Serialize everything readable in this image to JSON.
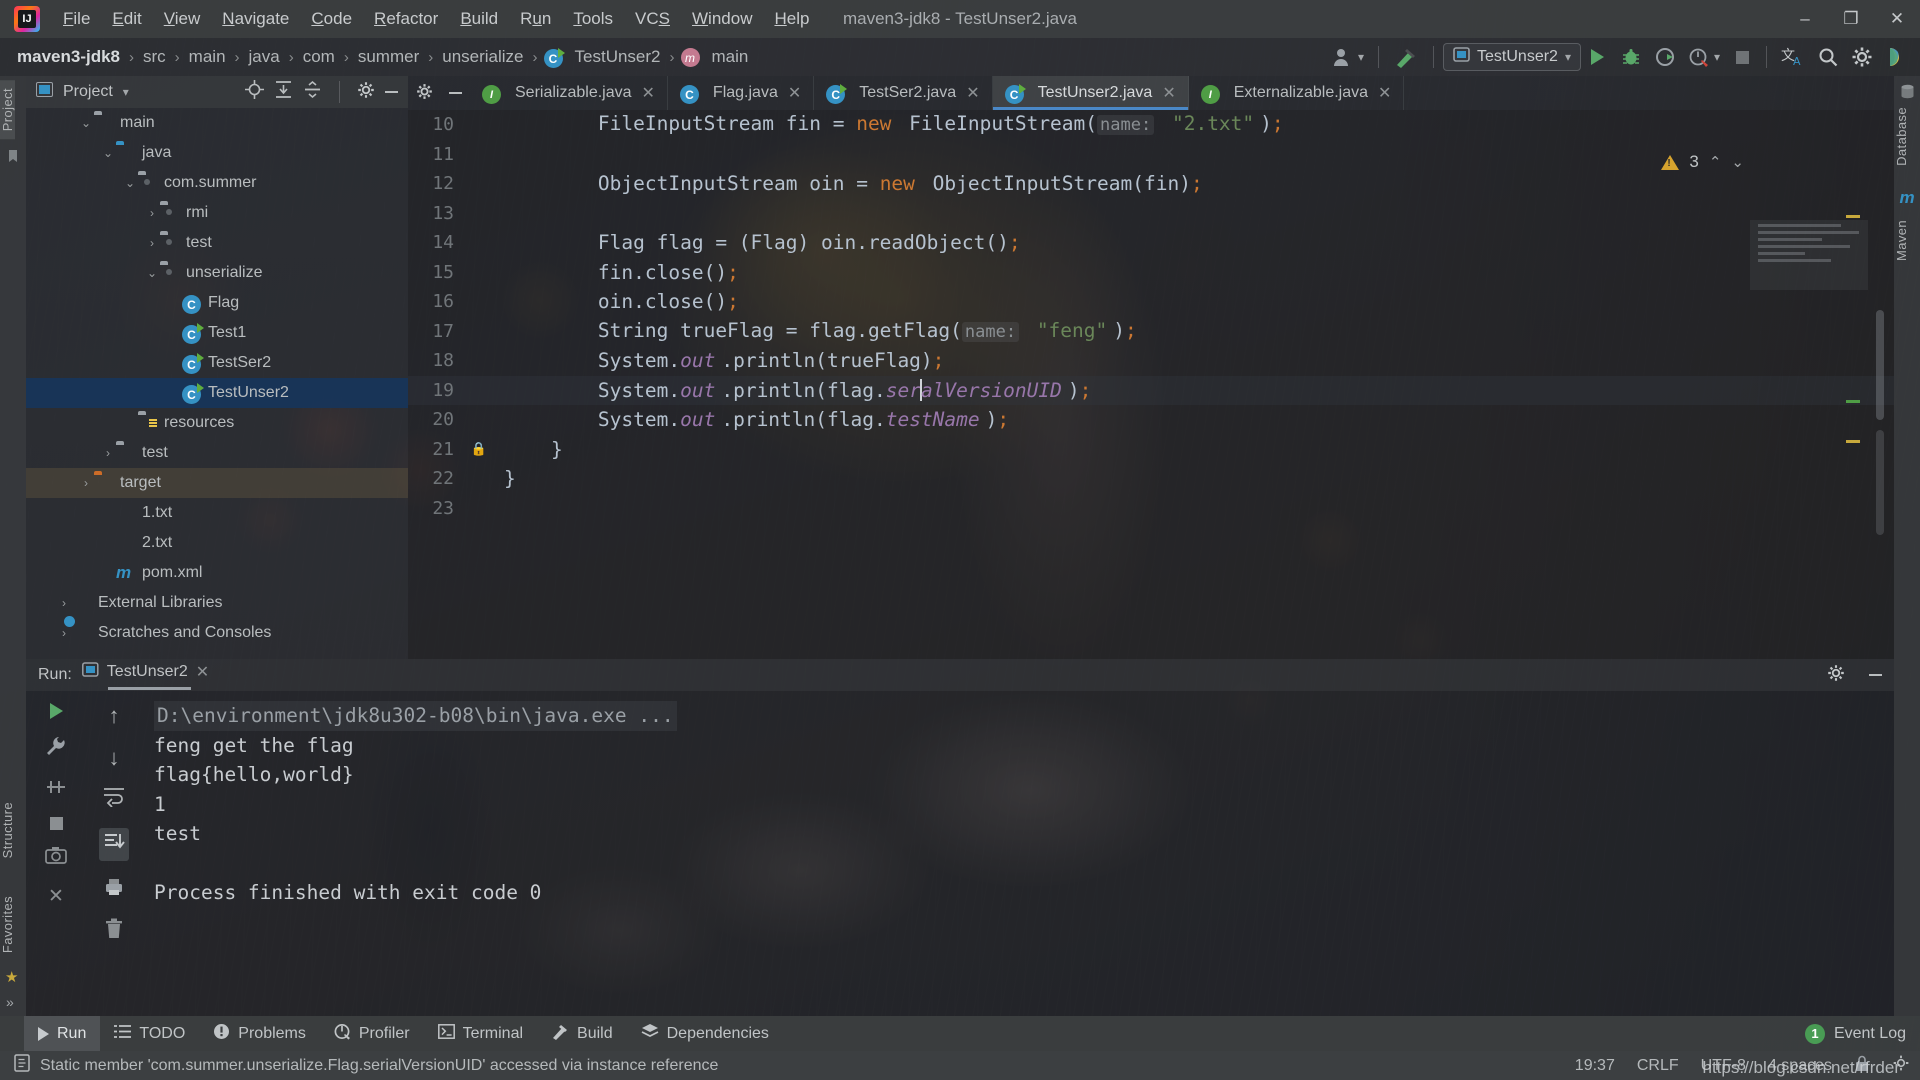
{
  "window": {
    "title": "maven3-jdk8 - TestUnser2.java",
    "logo": "intellij-idea-logo",
    "controls": {
      "minimize": "–",
      "maximize": "❐",
      "close": "✕"
    }
  },
  "menubar": {
    "items": [
      {
        "label": "File",
        "mnemonic": "F"
      },
      {
        "label": "Edit",
        "mnemonic": "E"
      },
      {
        "label": "View",
        "mnemonic": "V"
      },
      {
        "label": "Navigate",
        "mnemonic": "N"
      },
      {
        "label": "Code",
        "mnemonic": "C"
      },
      {
        "label": "Refactor",
        "mnemonic": "R"
      },
      {
        "label": "Build",
        "mnemonic": "B"
      },
      {
        "label": "Run",
        "mnemonic": "u"
      },
      {
        "label": "Tools",
        "mnemonic": "T"
      },
      {
        "label": "VCS",
        "mnemonic": "S"
      },
      {
        "label": "Window",
        "mnemonic": "W"
      },
      {
        "label": "Help",
        "mnemonic": "H"
      }
    ]
  },
  "navbar": {
    "crumbs": [
      {
        "label": "maven3-jdk8",
        "icon": "",
        "bold": true
      },
      {
        "label": "src",
        "icon": ""
      },
      {
        "label": "main",
        "icon": ""
      },
      {
        "label": "java",
        "icon": ""
      },
      {
        "label": "com",
        "icon": ""
      },
      {
        "label": "summer",
        "icon": ""
      },
      {
        "label": "unserialize",
        "icon": ""
      },
      {
        "label": "TestUnser2",
        "icon": "class-icon"
      },
      {
        "label": "main",
        "icon": "method-icon"
      }
    ],
    "separator": "›",
    "right": {
      "account_icon": "user-account-icon",
      "build_icon": "hammer-build-icon",
      "run_config": "TestUnser2",
      "run_config_icon": "run-configuration-icon",
      "dropdown_caret": "▾",
      "run_icon": "run-play-icon",
      "debug_icon": "debug-bug-icon",
      "coverage_icon": "run-with-coverage-icon",
      "profiler_icon": "profiler-icon",
      "stop_icon": "stop-icon",
      "translate_icon": "translate-icon",
      "search_icon": "search-everywhere-icon",
      "settings_icon": "settings-gear-icon",
      "updates_icon": "ide-updates-icon"
    }
  },
  "left_strip": {
    "items": [
      "Project",
      "Structure",
      "Favorites"
    ],
    "selected": "Project",
    "bookmark_icon": "bookmark-icon",
    "expand_icon": "»"
  },
  "right_strip": {
    "items": [
      "Database",
      "Maven"
    ],
    "icons": [
      "database-icon",
      "maven-m-icon"
    ]
  },
  "project_panel": {
    "title": "Project",
    "title_caret": "▾",
    "toolbar": [
      "locate-icon",
      "expand-all-icon",
      "collapse-all-icon",
      "settings-gear-icon",
      "hide-icon"
    ],
    "tree": [
      {
        "label": "main",
        "indent": 2,
        "arrow": "⌄",
        "icon": "folder"
      },
      {
        "label": "java",
        "indent": 3,
        "arrow": "⌄",
        "icon": "folder-blue"
      },
      {
        "label": "com.summer",
        "indent": 4,
        "arrow": "⌄",
        "icon": "folder-package"
      },
      {
        "label": "rmi",
        "indent": 5,
        "arrow": "›",
        "icon": "folder-package"
      },
      {
        "label": "test",
        "indent": 5,
        "arrow": "›",
        "icon": "folder-package"
      },
      {
        "label": "unserialize",
        "indent": 5,
        "arrow": "⌄",
        "icon": "folder-package"
      },
      {
        "label": "Flag",
        "indent": 6,
        "arrow": "",
        "icon": "class"
      },
      {
        "label": "Test1",
        "indent": 6,
        "arrow": "",
        "icon": "class-runnable"
      },
      {
        "label": "TestSer2",
        "indent": 6,
        "arrow": "",
        "icon": "class-runnable"
      },
      {
        "label": "TestUnser2",
        "indent": 6,
        "arrow": "",
        "icon": "class-runnable",
        "selected": true
      },
      {
        "label": "resources",
        "indent": 4,
        "arrow": "",
        "icon": "folder-resources"
      },
      {
        "label": "test",
        "indent": 3,
        "arrow": "›",
        "icon": "folder"
      },
      {
        "label": "target",
        "indent": 2,
        "arrow": "›",
        "icon": "folder-orange",
        "hover": true
      },
      {
        "label": "1.txt",
        "indent": 3,
        "arrow": "",
        "icon": "textfile"
      },
      {
        "label": "2.txt",
        "indent": 3,
        "arrow": "",
        "icon": "textfile"
      },
      {
        "label": "pom.xml",
        "indent": 3,
        "arrow": "",
        "icon": "maven-m"
      },
      {
        "label": "External Libraries",
        "indent": 1,
        "arrow": "›",
        "icon": "libraries"
      },
      {
        "label": "Scratches and Consoles",
        "indent": 1,
        "arrow": "›",
        "icon": "scratches"
      }
    ]
  },
  "editor": {
    "gear_icon": "settings-gear-icon",
    "hide_icon": "hide-panel-icon",
    "tabs": [
      {
        "label": "Serializable.java",
        "icon": "interface-icon",
        "active": false
      },
      {
        "label": "Flag.java",
        "icon": "class-icon",
        "active": false
      },
      {
        "label": "TestSer2.java",
        "icon": "class-runnable-icon",
        "active": false
      },
      {
        "label": "TestUnser2.java",
        "icon": "class-runnable-icon",
        "active": true
      },
      {
        "label": "Externalizable.java",
        "icon": "interface-icon",
        "active": false
      }
    ],
    "close_glyph": "✕",
    "inspection": {
      "count": "3",
      "icon": "warning-triangle-icon",
      "up": "⌃",
      "down": "⌄"
    },
    "lines": [
      {
        "n": "10",
        "fold": "",
        "tokens": [
          {
            "t": "        FileInputStream fin = ",
            "c": "ctext"
          },
          {
            "t": "new",
            "c": "kw"
          },
          {
            "t": " FileInputStream(",
            "c": "ctext"
          },
          {
            "t": "name:",
            "c": "hint"
          },
          {
            "t": " ",
            "c": "ctext"
          },
          {
            "t": "\"2.txt\"",
            "c": "str"
          },
          {
            "t": ")",
            "c": "ctext"
          },
          {
            "t": ";",
            "c": "semi-c"
          }
        ]
      },
      {
        "n": "11",
        "fold": "",
        "tokens": []
      },
      {
        "n": "12",
        "fold": "",
        "tokens": [
          {
            "t": "        ObjectInputStream oin = ",
            "c": "ctext"
          },
          {
            "t": "new",
            "c": "kw"
          },
          {
            "t": " ObjectInputStream(fin)",
            "c": "ctext"
          },
          {
            "t": ";",
            "c": "semi-c"
          }
        ]
      },
      {
        "n": "13",
        "fold": "",
        "tokens": []
      },
      {
        "n": "14",
        "fold": "",
        "tokens": [
          {
            "t": "        Flag flag = (Flag) oin.readObject()",
            "c": "ctext"
          },
          {
            "t": ";",
            "c": "semi-c"
          }
        ]
      },
      {
        "n": "15",
        "fold": "",
        "tokens": [
          {
            "t": "        fin.close()",
            "c": "ctext"
          },
          {
            "t": ";",
            "c": "semi-c"
          }
        ]
      },
      {
        "n": "16",
        "fold": "",
        "tokens": [
          {
            "t": "        oin.close()",
            "c": "ctext"
          },
          {
            "t": ";",
            "c": "semi-c"
          }
        ]
      },
      {
        "n": "17",
        "fold": "",
        "tokens": [
          {
            "t": "        String trueFlag = flag.getFlag(",
            "c": "ctext"
          },
          {
            "t": "name:",
            "c": "hint"
          },
          {
            "t": " ",
            "c": "ctext"
          },
          {
            "t": "\"feng\"",
            "c": "str"
          },
          {
            "t": ")",
            "c": "ctext"
          },
          {
            "t": ";",
            "c": "semi-c"
          }
        ]
      },
      {
        "n": "18",
        "fold": "",
        "tokens": [
          {
            "t": "        System.",
            "c": "ctext"
          },
          {
            "t": "out",
            "c": "fld"
          },
          {
            "t": ".println(trueFlag)",
            "c": "ctext"
          },
          {
            "t": ";",
            "c": "semi-c"
          }
        ]
      },
      {
        "n": "19",
        "fold": "",
        "current": true,
        "tokens": [
          {
            "t": "        System.",
            "c": "ctext"
          },
          {
            "t": "out",
            "c": "fld"
          },
          {
            "t": ".println(flag.",
            "c": "ctext"
          },
          {
            "t": "ser",
            "c": "sfld"
          },
          {
            "t": "|",
            "c": "caret"
          },
          {
            "t": "alVersionUID",
            "c": "sfld"
          },
          {
            "t": ")",
            "c": "ctext"
          },
          {
            "t": ";",
            "c": "semi-c"
          }
        ]
      },
      {
        "n": "20",
        "fold": "",
        "tokens": [
          {
            "t": "        System.",
            "c": "ctext"
          },
          {
            "t": "out",
            "c": "fld"
          },
          {
            "t": ".println(flag.",
            "c": "ctext"
          },
          {
            "t": "testName",
            "c": "sfld"
          },
          {
            "t": ")",
            "c": "ctext"
          },
          {
            "t": ";",
            "c": "semi-c"
          }
        ]
      },
      {
        "n": "21",
        "fold": "lock",
        "tokens": [
          {
            "t": "    }",
            "c": "ctext"
          }
        ]
      },
      {
        "n": "22",
        "fold": "",
        "tokens": [
          {
            "t": "}",
            "c": "ctext"
          }
        ]
      },
      {
        "n": "23",
        "fold": "",
        "tokens": []
      }
    ]
  },
  "run_panel": {
    "label": "Run:",
    "tab_label": "TestUnser2",
    "tab_icon": "run-configuration-icon",
    "tab_close": "✕",
    "gear_icon": "settings-gear-icon",
    "hide_icon": "hide-panel-icon",
    "side_icons": [
      "rerun-play-icon",
      "wrench-settings-icon",
      "thread-dump-icon",
      "stop-icon",
      "camera-snapshot-icon",
      "soft-wrap-icon"
    ],
    "side_icons2": [
      "scroll-up-icon",
      "scroll-down-icon",
      "soft-wrap-icon",
      "scroll-to-end-icon",
      "print-icon",
      "trash-icon"
    ],
    "console": [
      {
        "text": "D:\\environment\\jdk8u302-b08\\bin\\java.exe ...",
        "style": "cmd"
      },
      {
        "text": "feng get the flag",
        "style": "out"
      },
      {
        "text": "flag{hello,world}",
        "style": "out"
      },
      {
        "text": "1",
        "style": "out"
      },
      {
        "text": "test",
        "style": "out"
      },
      {
        "text": "",
        "style": "out"
      },
      {
        "text": "Process finished with exit code 0",
        "style": "out"
      }
    ]
  },
  "bottom_bar": {
    "items": [
      {
        "label": "Run",
        "icon": "run-play-icon",
        "selected": true
      },
      {
        "label": "TODO",
        "icon": "todo-list-icon",
        "selected": false
      },
      {
        "label": "Problems",
        "icon": "problems-icon",
        "selected": false
      },
      {
        "label": "Profiler",
        "icon": "profiler-icon",
        "selected": false
      },
      {
        "label": "Terminal",
        "icon": "terminal-icon",
        "selected": false
      },
      {
        "label": "Build",
        "icon": "hammer-build-icon",
        "selected": false
      },
      {
        "label": "Dependencies",
        "icon": "dependencies-icon",
        "selected": false
      }
    ],
    "event_log": {
      "label": "Event Log",
      "badge": "1",
      "icon": "event-log-badge"
    }
  },
  "status_bar": {
    "icon": "inspection-message-icon",
    "message": "Static member 'com.summer.unserialize.Flag.serialVersionUID' accessed via instance reference",
    "caret": "19:37",
    "line_separator": "CRLF",
    "encoding": "UTF-8",
    "indent": "4 spaces",
    "lock_icon": "read-only-lock-icon",
    "inspection_icon": "inspections-widget-icon",
    "watermark": "https://blog.csdn.net/rfrder"
  },
  "colors": {
    "accent_blue": "#3592c4",
    "selection_blue": "#16365c",
    "keyword_orange": "#cc7832",
    "string_green": "#6a8759",
    "field_purple": "#9876aa",
    "warning_yellow": "#d6a32e",
    "run_green": "#59a869",
    "chrome_gray": "#3c3f41"
  }
}
